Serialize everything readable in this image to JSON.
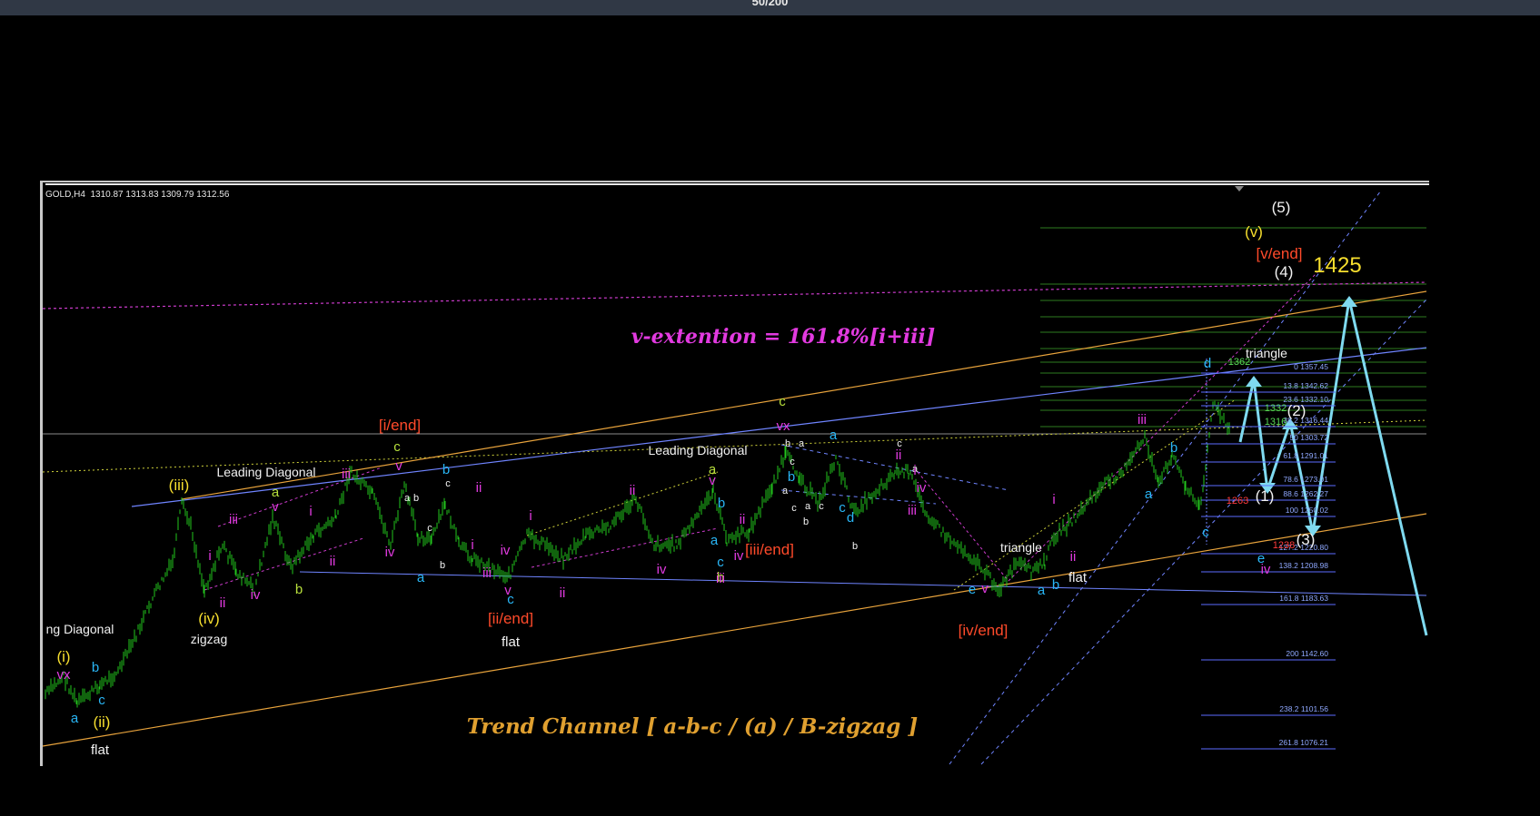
{
  "top_bar": {
    "counter": "50/200"
  },
  "chart": {
    "symbol_info": "GOLD,H4  1310.87 1313.83 1309.79 1312.56",
    "titles": {
      "v_extension": "v-extention = 161.8%[i+iii]",
      "trend_channel": "Trend Channel  [ a-b-c / (a) / B-zigzag ]"
    },
    "colors": {
      "candles": "#22c61d",
      "channel": "#e8a33c",
      "blue_line": "#6f84ff",
      "magenta_dash": "#cc3bcc",
      "forecast": "#7fdaf0",
      "fib": "#5b6dff",
      "grid_green": "#2e7d1f",
      "label_red": "#ff4a2a",
      "label_yellow": "#f7df2e",
      "label_magenta": "#e23ae0",
      "label_cyan": "#29b6f6"
    },
    "price_markers": [
      {
        "text": "1362",
        "color": "#58d957"
      },
      {
        "text": "1332",
        "color": "#58d957"
      },
      {
        "text": "1316",
        "color": "#58d957"
      },
      {
        "text": "1263",
        "color": "#ff3b3b"
      },
      {
        "text": "1238",
        "color": "#ff3b3b"
      }
    ],
    "target": "1425",
    "fib_levels": [
      {
        "text": "0 1357.45"
      },
      {
        "text": "13.8 1342.62"
      },
      {
        "text": "23.6 1332.10"
      },
      {
        "text": "38.2 1316.44"
      },
      {
        "text": "50 1303.72"
      },
      {
        "text": "61.8 1291.01"
      },
      {
        "text": "78.6 1273.01"
      },
      {
        "text": "88.6 1262.27"
      },
      {
        "text": "100 1250.02"
      },
      {
        "text": "127.2 1220.80"
      },
      {
        "text": "138.2 1208.98"
      },
      {
        "text": "161.8 1183.63"
      },
      {
        "text": "200 1142.60"
      },
      {
        "text": "238.2 1101.56"
      },
      {
        "text": "261.8 1076.21"
      }
    ],
    "wave_labels": [
      {
        "text": "ng Diagonal",
        "color": "#f2f2f2"
      },
      {
        "text": "(i)",
        "color": "#f7df2e"
      },
      {
        "text": "vx",
        "color": "#e23ae0"
      },
      {
        "text": "a",
        "color": "#29b6f6"
      },
      {
        "text": "b",
        "color": "#29b6f6"
      },
      {
        "text": "c",
        "color": "#29b6f6"
      },
      {
        "text": "(ii)",
        "color": "#f7df2e"
      },
      {
        "text": "flat",
        "color": "#f2f2f2"
      },
      {
        "text": "(iii)",
        "color": "#f7df2e"
      },
      {
        "text": "Leading Diagonal",
        "color": "#f2f2f2"
      },
      {
        "text": "i",
        "color": "#e23ae0"
      },
      {
        "text": "ii",
        "color": "#e23ae0"
      },
      {
        "text": "iii",
        "color": "#e23ae0"
      },
      {
        "text": "iv",
        "color": "#e23ae0"
      },
      {
        "text": "v",
        "color": "#e23ae0"
      },
      {
        "text": "a",
        "color": "#b8e03c"
      },
      {
        "text": "b",
        "color": "#b8e03c"
      },
      {
        "text": "c",
        "color": "#b8e03c"
      },
      {
        "text": "(iv)",
        "color": "#f7df2e"
      },
      {
        "text": "zigzag",
        "color": "#f2f2f2"
      },
      {
        "text": "[i/end]",
        "color": "#ff4a2a"
      },
      {
        "text": "i",
        "color": "#e23ae0"
      },
      {
        "text": "ii",
        "color": "#e23ae0"
      },
      {
        "text": "iii",
        "color": "#e23ae0"
      },
      {
        "text": "iv",
        "color": "#e23ae0"
      },
      {
        "text": "v",
        "color": "#e23ae0"
      },
      {
        "text": "a",
        "color": "#f2f2f2"
      },
      {
        "text": "b",
        "color": "#f2f2f2"
      },
      {
        "text": "c",
        "color": "#f2f2f2"
      },
      {
        "text": "b",
        "color": "#f2f2f2"
      },
      {
        "text": "a",
        "color": "#29b6f6"
      },
      {
        "text": "b",
        "color": "#29b6f6"
      },
      {
        "text": "c",
        "color": "#f2f2f2"
      },
      {
        "text": "ii",
        "color": "#e23ae0"
      },
      {
        "text": "i",
        "color": "#e23ae0"
      },
      {
        "text": "iv",
        "color": "#e23ae0"
      },
      {
        "text": "iii",
        "color": "#e23ae0"
      },
      {
        "text": "v",
        "color": "#e23ae0"
      },
      {
        "text": "c",
        "color": "#29b6f6"
      },
      {
        "text": "[ii/end]",
        "color": "#ff4a2a"
      },
      {
        "text": "flat",
        "color": "#f2f2f2"
      },
      {
        "text": "i",
        "color": "#e23ae0"
      },
      {
        "text": "ii",
        "color": "#e23ae0"
      },
      {
        "text": "ii",
        "color": "#e23ae0"
      },
      {
        "text": "iv",
        "color": "#e23ae0"
      },
      {
        "text": "Leading Diagonal",
        "color": "#f2f2f2"
      },
      {
        "text": "a",
        "color": "#b8e03c"
      },
      {
        "text": "v",
        "color": "#e23ae0"
      },
      {
        "text": "b",
        "color": "#29b6f6"
      },
      {
        "text": "a",
        "color": "#29b6f6"
      },
      {
        "text": "c",
        "color": "#29b6f6"
      },
      {
        "text": "b",
        "color": "#b8e03c"
      },
      {
        "text": "iii",
        "color": "#e23ae0"
      },
      {
        "text": "ii",
        "color": "#e23ae0"
      },
      {
        "text": "iv",
        "color": "#e23ae0"
      },
      {
        "text": "[iii/end]",
        "color": "#ff4a2a"
      },
      {
        "text": "c",
        "color": "#b8e03c"
      },
      {
        "text": "vx",
        "color": "#e23ae0"
      },
      {
        "text": "b",
        "color": "#f2f2f2"
      },
      {
        "text": "a",
        "color": "#f2f2f2"
      },
      {
        "text": "b",
        "color": "#29b6f6"
      },
      {
        "text": "c",
        "color": "#f2f2f2"
      },
      {
        "text": "a",
        "color": "#f2f2f2"
      },
      {
        "text": "c",
        "color": "#f2f2f2"
      },
      {
        "text": "b",
        "color": "#f2f2f2"
      },
      {
        "text": "a",
        "color": "#29b6f6"
      },
      {
        "text": "a",
        "color": "#f2f2f2"
      },
      {
        "text": "c",
        "color": "#f2f2f2"
      },
      {
        "text": "c",
        "color": "#29b6f6"
      },
      {
        "text": "b",
        "color": "#f2f2f2"
      },
      {
        "text": "d",
        "color": "#29b6f6"
      },
      {
        "text": "c",
        "color": "#f2f2f2"
      },
      {
        "text": "ii",
        "color": "#e23ae0"
      },
      {
        "text": "a",
        "color": "#f2f2f2"
      },
      {
        "text": "i",
        "color": "#e23ae0"
      },
      {
        "text": "iv",
        "color": "#e23ae0"
      },
      {
        "text": "iii",
        "color": "#e23ae0"
      },
      {
        "text": "v",
        "color": "#e23ae0"
      },
      {
        "text": "e",
        "color": "#29b6f6"
      },
      {
        "text": "[iv/end]",
        "color": "#ff4a2a"
      },
      {
        "text": "triangle",
        "color": "#f2f2f2"
      },
      {
        "text": "a",
        "color": "#29b6f6"
      },
      {
        "text": "b",
        "color": "#29b6f6"
      },
      {
        "text": "flat",
        "color": "#f2f2f2"
      },
      {
        "text": "i",
        "color": "#e23ae0"
      },
      {
        "text": "ii",
        "color": "#e23ae0"
      },
      {
        "text": "iii",
        "color": "#e23ae0"
      },
      {
        "text": "a",
        "color": "#29b6f6"
      },
      {
        "text": "b",
        "color": "#29b6f6"
      },
      {
        "text": "c",
        "color": "#29b6f6"
      },
      {
        "text": "d",
        "color": "#29b6f6"
      },
      {
        "text": "e",
        "color": "#29b6f6"
      },
      {
        "text": "iv",
        "color": "#e23ae0"
      },
      {
        "text": "triangle",
        "color": "#f2f2f2"
      },
      {
        "text": "(1)",
        "color": "#f2f2f2"
      },
      {
        "text": "(2)",
        "color": "#f2f2f2"
      },
      {
        "text": "(3)",
        "color": "#f2f2f2"
      },
      {
        "text": "(4)",
        "color": "#f2f2f2"
      },
      {
        "text": "(5)",
        "color": "#f2f2f2"
      },
      {
        "text": "(v)",
        "color": "#f7df2e"
      },
      {
        "text": "[v/end]",
        "color": "#ff4a2a"
      },
      {
        "text": "vx",
        "color": "#e23ae0"
      }
    ]
  }
}
